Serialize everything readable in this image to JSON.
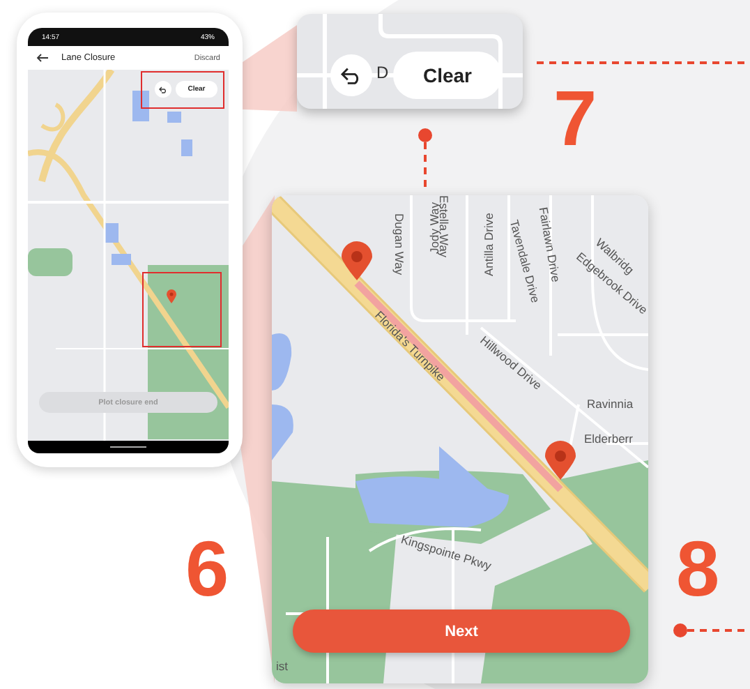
{
  "phone": {
    "status_bar": {
      "time": "14:57",
      "battery": "43%"
    },
    "header": {
      "title": "Lane Closure",
      "action": "Discard"
    },
    "clear_button": "Clear",
    "plot_button": "Plot closure end"
  },
  "zoom_controls": {
    "map_label": "D",
    "clear_button": "Clear"
  },
  "zoom_map": {
    "street_labels": [
      {
        "text": "Dugan Way"
      },
      {
        "text": "Jody Way"
      },
      {
        "text": "Estella Way"
      },
      {
        "text": "Antilla Drive"
      },
      {
        "text": "Tavendale Drive"
      },
      {
        "text": "Fairlawn Drive"
      },
      {
        "text": "Edgebrook Drive"
      },
      {
        "text": "Walbridg"
      },
      {
        "text": "Florida's Turnpike"
      },
      {
        "text": "Hillwood Drive"
      },
      {
        "text": "Ravinnia"
      },
      {
        "text": "Elderberr"
      },
      {
        "text": "Kingspointe Pkwy"
      },
      {
        "text": "ist"
      }
    ],
    "next_button": "Next"
  },
  "step_numbers": [
    "6",
    "7",
    "8"
  ]
}
